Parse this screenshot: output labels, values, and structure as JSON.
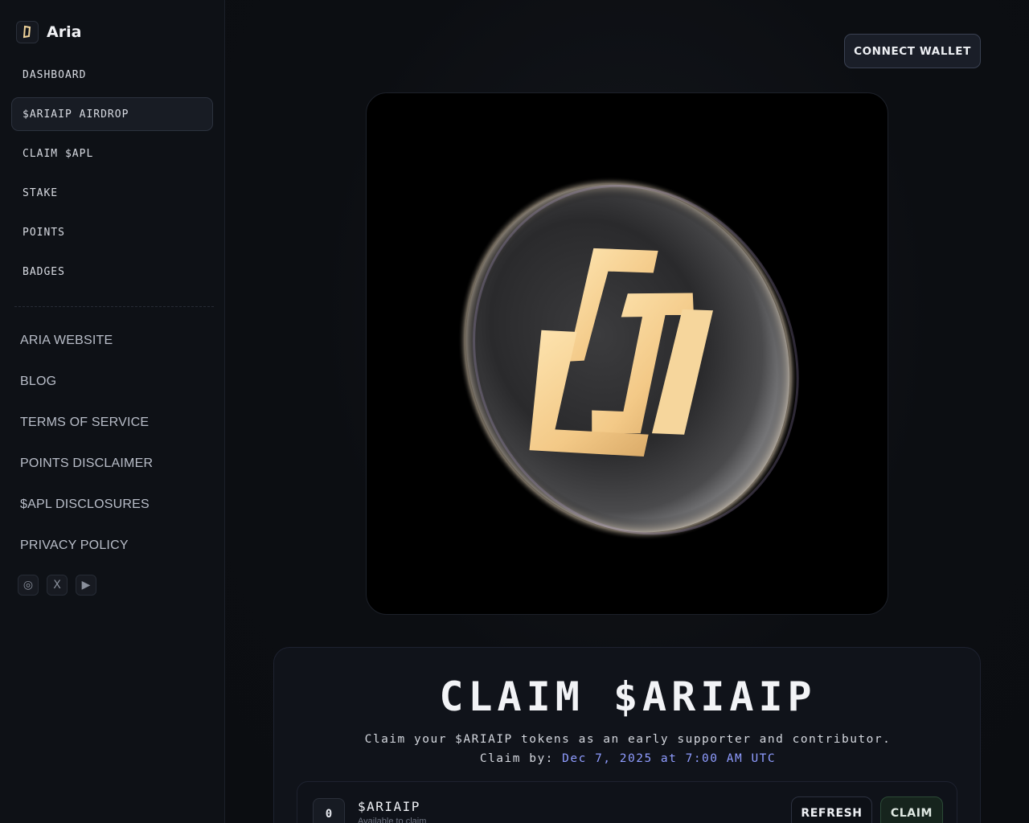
{
  "brand": {
    "name": "Aria",
    "logo_icon": "aria-logo-icon"
  },
  "nav": {
    "items": [
      {
        "label": "DASHBOARD",
        "active": false
      },
      {
        "label": "$ARIAIP AIRDROP",
        "active": true
      },
      {
        "label": "CLAIM $APL",
        "active": false
      },
      {
        "label": "STAKE",
        "active": false
      },
      {
        "label": "POINTS",
        "active": false
      },
      {
        "label": "BADGES",
        "active": false
      }
    ]
  },
  "links": {
    "items": [
      {
        "label": "ARIA WEBSITE"
      },
      {
        "label": "BLOG"
      },
      {
        "label": "TERMS OF SERVICE"
      },
      {
        "label": "POINTS DISCLAIMER"
      },
      {
        "label": "$APL DISCLOSURES"
      },
      {
        "label": "PRIVACY POLICY"
      }
    ]
  },
  "socials": [
    {
      "icon": "instagram-icon",
      "glyph": "◎"
    },
    {
      "icon": "x-twitter-icon",
      "glyph": "X"
    },
    {
      "icon": "youtube-icon",
      "glyph": "▶"
    }
  ],
  "header": {
    "connect_label": "CONNECT WALLET"
  },
  "hero": {
    "image": "aria-coin-logo-image"
  },
  "claim": {
    "title": "CLAIM $ARIAIP",
    "description": "Claim your $ARIAIP tokens as an early supporter and contributor.",
    "claim_by_label": "Claim by:",
    "claim_by_date": "Dec 7, 2025 at 7:00 AM UTC",
    "token": {
      "amount": "0",
      "name": "$ARIAIP",
      "subtitle": "Available to claim"
    },
    "refresh_label": "REFRESH",
    "claim_label": "CLAIM"
  },
  "colors": {
    "background": "#0b0d11",
    "sidebar": "#0e1116",
    "accent_date": "#8f9cff",
    "claim_button_bg": "#16241d",
    "coin_gold": "#f5cf8e"
  }
}
